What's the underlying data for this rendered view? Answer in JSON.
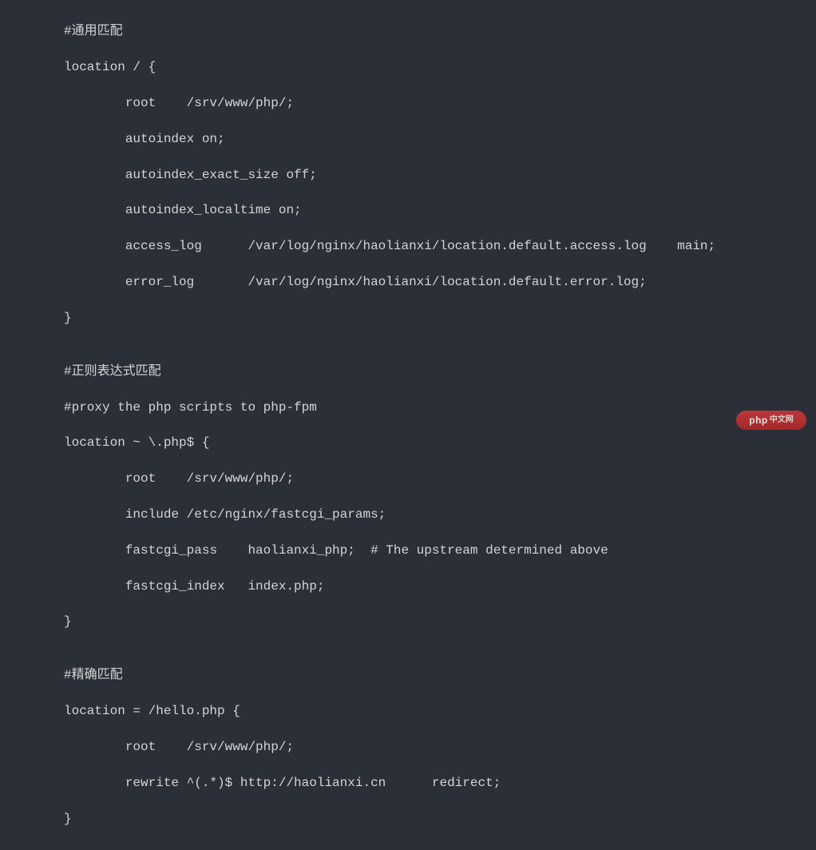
{
  "code": {
    "lines": [
      "#通用匹配",
      "location / {",
      "        root    /srv/www/php/;",
      "        autoindex on;",
      "        autoindex_exact_size off;",
      "        autoindex_localtime on;",
      "        access_log      /var/log/nginx/haolianxi/location.default.access.log    main;",
      "        error_log       /var/log/nginx/haolianxi/location.default.error.log;",
      "}",
      "",
      "#正则表达式匹配",
      "#proxy the php scripts to php-fpm",
      "location ~ \\.php$ {",
      "        root    /srv/www/php/;",
      "        include /etc/nginx/fastcgi_params;",
      "        fastcgi_pass    haolianxi_php;  # The upstream determined above",
      "        fastcgi_index   index.php;",
      "}",
      "",
      "#精确匹配",
      "location = /hello.php {",
      "        root    /srv/www/php/;",
      "        rewrite ^(.*)$ http://haolianxi.cn      redirect;",
      "}"
    ]
  },
  "watermark": {
    "brand": "php",
    "suffix": "中文网"
  }
}
